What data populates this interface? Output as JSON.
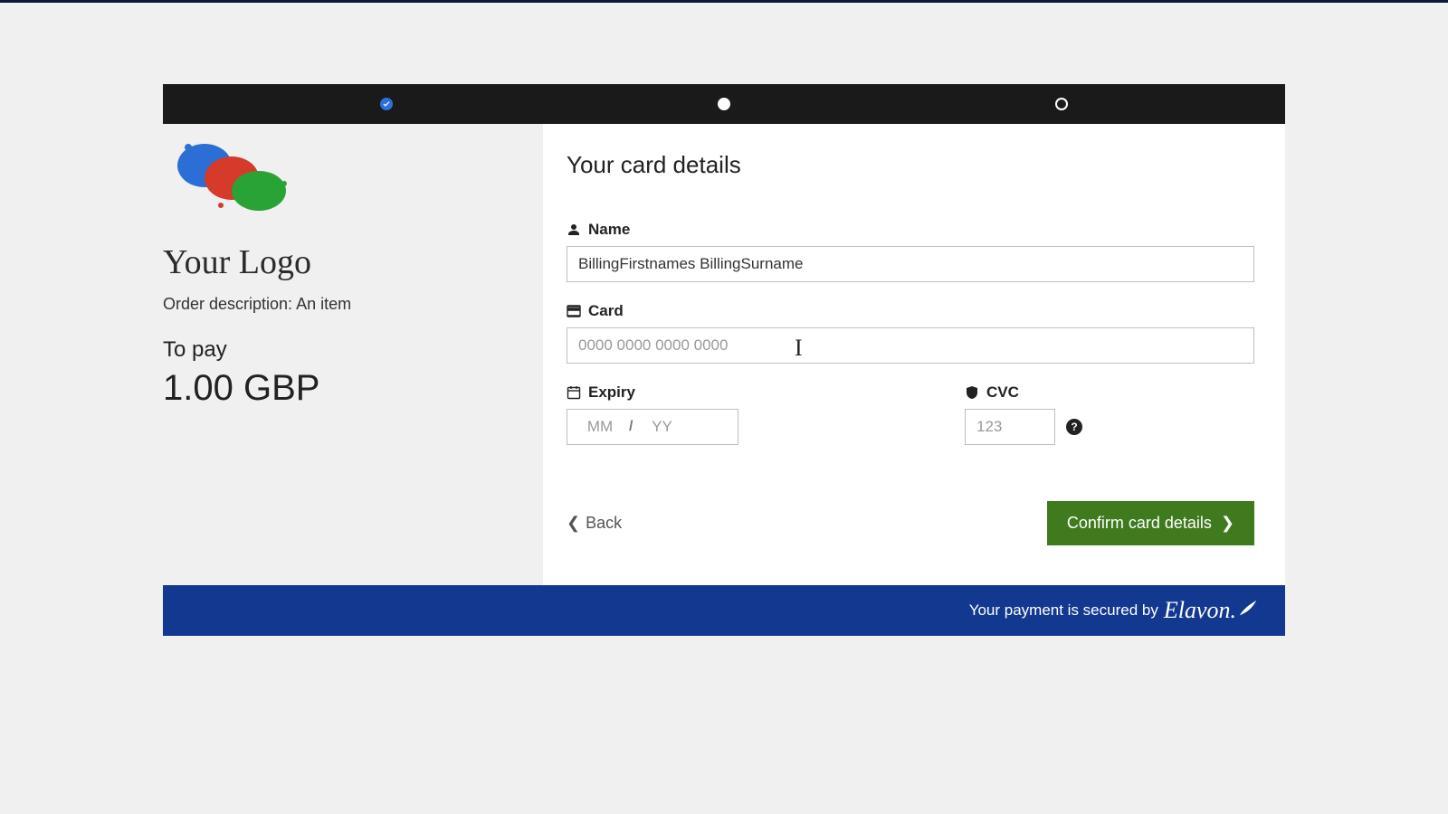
{
  "progress": {
    "step1": "done",
    "step2": "current",
    "step3": "future"
  },
  "left": {
    "logo_text": "Your Logo",
    "order_description": "Order description: An item",
    "to_pay_label": "To pay",
    "to_pay_amount": "1.00 GBP"
  },
  "form": {
    "title": "Your card details",
    "name_label": "Name",
    "name_value": "BillingFirstnames BillingSurname",
    "card_label": "Card",
    "card_placeholder": "0000 0000 0000 0000",
    "expiry_label": "Expiry",
    "expiry_mm_placeholder": "MM",
    "expiry_sep": "/",
    "expiry_yy_placeholder": "YY",
    "cvc_label": "CVC",
    "cvc_placeholder": "123",
    "back_label": "Back",
    "confirm_label": "Confirm card details"
  },
  "footer": {
    "secured_text": "Your payment is secured by",
    "brand": "Elavon."
  }
}
